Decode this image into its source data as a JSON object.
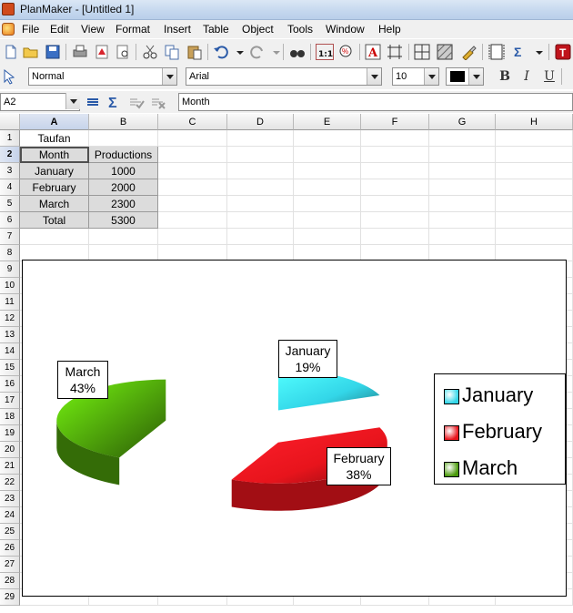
{
  "window": {
    "title": "PlanMaker - [Untitled 1]"
  },
  "menu": [
    "File",
    "Edit",
    "View",
    "Format",
    "Insert",
    "Table",
    "Object",
    "Tools",
    "Window",
    "Help"
  ],
  "format_bar": {
    "style": "Normal",
    "font": "Arial",
    "size": "10"
  },
  "formula_bar": {
    "cell_ref": "A2",
    "content": "Month"
  },
  "columns": [
    "A",
    "B",
    "C",
    "D",
    "E",
    "F",
    "G",
    "H"
  ],
  "rows": [
    "1",
    "2",
    "3",
    "4",
    "5",
    "6",
    "7",
    "8",
    "9",
    "10",
    "11",
    "12",
    "13",
    "14",
    "15",
    "16",
    "17",
    "18",
    "19",
    "20",
    "21",
    "22",
    "23",
    "24",
    "25",
    "26",
    "27",
    "28",
    "29"
  ],
  "sheet": {
    "a1": "Taufan",
    "header": [
      "Month",
      "Productions"
    ],
    "data": [
      [
        "January",
        "1000"
      ],
      [
        "February",
        "2000"
      ],
      [
        "March",
        "2300"
      ],
      [
        "Total",
        "5300"
      ]
    ]
  },
  "chart_data": {
    "type": "pie",
    "categories": [
      "January",
      "February",
      "March"
    ],
    "values": [
      19,
      38,
      43
    ],
    "data_labels": [
      {
        "name": "January",
        "pct": "19%"
      },
      {
        "name": "February",
        "pct": "38%"
      },
      {
        "name": "March",
        "pct": "43%"
      }
    ],
    "legend": [
      "January",
      "February",
      "March"
    ],
    "legend_position": "right",
    "colors": {
      "January": "#33d6e8",
      "February": "#e8141c",
      "March": "#4a9a0a"
    }
  }
}
